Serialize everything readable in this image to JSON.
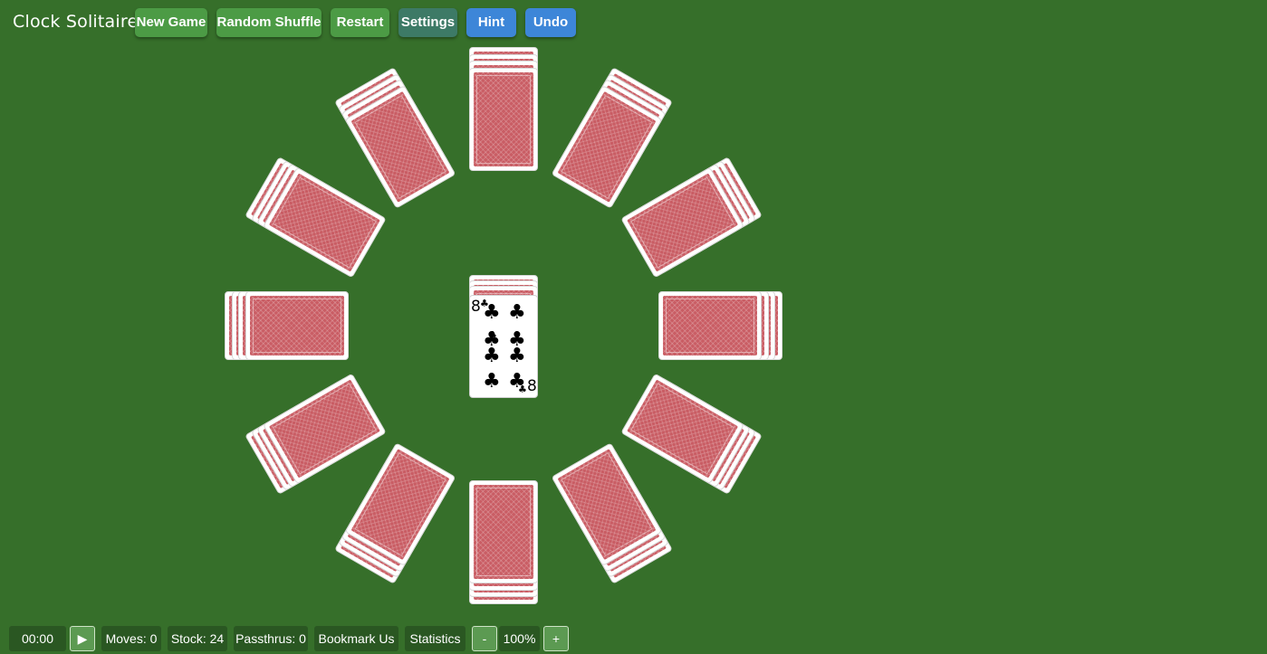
{
  "app": {
    "title": "Clock Solitaire"
  },
  "toolbar": {
    "new_game": "New Game",
    "random_shuffle": "Random Shuffle",
    "restart": "Restart",
    "settings": "Settings",
    "hint": "Hint",
    "undo": "Undo"
  },
  "colors": {
    "felt": "#366f2a",
    "card_back": "#c95d64",
    "button_green": "#4c9b45",
    "button_teal": "#3d7a66",
    "button_blue": "#3d86d8"
  },
  "board": {
    "piles": 13,
    "face_down_per_pile": 4,
    "center_top_card": {
      "rank": "8",
      "suit": "♣"
    }
  },
  "status": {
    "timer": "00:00",
    "play_icon": "▶",
    "moves": "Moves: 0",
    "stock": "Stock: 24",
    "passthrus": "Passthrus: 0",
    "bookmark": "Bookmark Us",
    "statistics": "Statistics",
    "zoom_out": "-",
    "zoom": "100%",
    "zoom_in": "+"
  }
}
